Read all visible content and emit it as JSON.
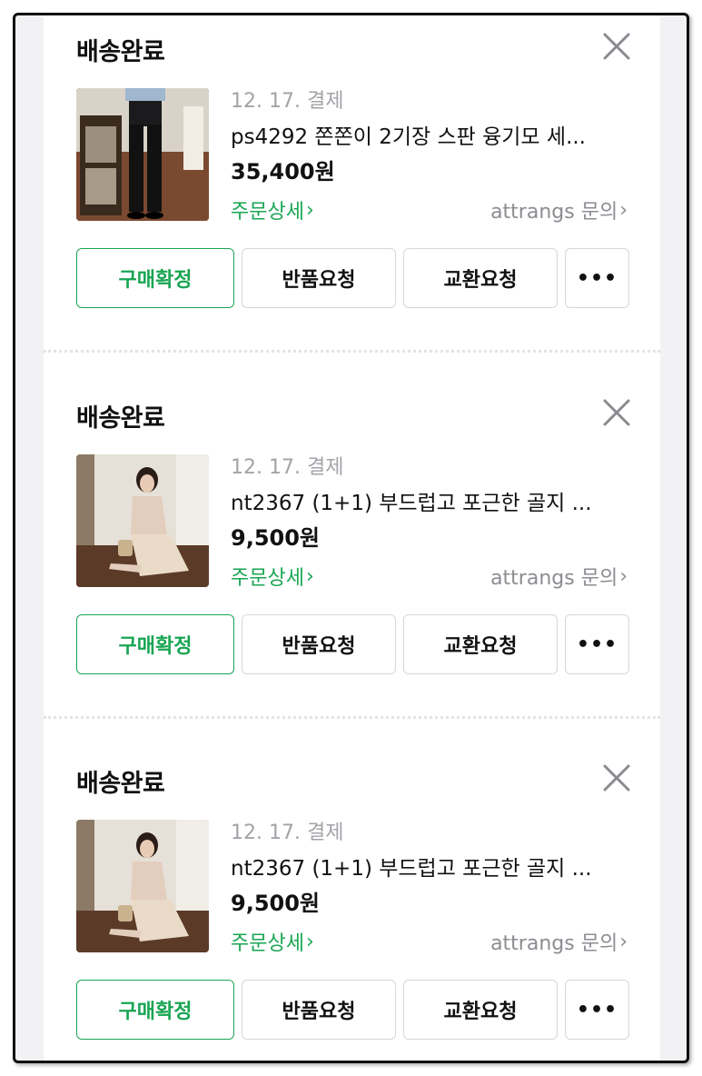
{
  "orders": [
    {
      "status": "배송완료",
      "date": "12. 17. 결제",
      "title": "ps4292 쫀쫀이 2기장 스판 융기모 세...",
      "price": "35,400원",
      "detail_link": "주문상세",
      "seller_link": "attrangs 문의",
      "buttons": {
        "confirm": "구매확정",
        "return": "반품요청",
        "exchange": "교환요청",
        "more": "•••"
      },
      "thumb_icon": "black-pants-photo"
    },
    {
      "status": "배송완료",
      "date": "12. 17. 결제",
      "title": "nt2367 (1+1) 부드럽고 포근한 골지 ...",
      "price": "9,500원",
      "detail_link": "주문상세",
      "seller_link": "attrangs 문의",
      "buttons": {
        "confirm": "구매확정",
        "return": "반품요청",
        "exchange": "교환요청",
        "more": "•••"
      },
      "thumb_icon": "beige-knit-dress-photo"
    },
    {
      "status": "배송완료",
      "date": "12. 17. 결제",
      "title": "nt2367 (1+1) 부드럽고 포근한 골지 ...",
      "price": "9,500원",
      "detail_link": "주문상세",
      "seller_link": "attrangs 문의",
      "buttons": {
        "confirm": "구매확정",
        "return": "반품요청",
        "exchange": "교환요청",
        "more": "•••"
      },
      "thumb_icon": "beige-knit-dress-photo"
    }
  ],
  "colors": {
    "accent": "#19a553",
    "muted": "#8c8c92",
    "date": "#a3a3a8",
    "border": "#d7d7dc"
  }
}
